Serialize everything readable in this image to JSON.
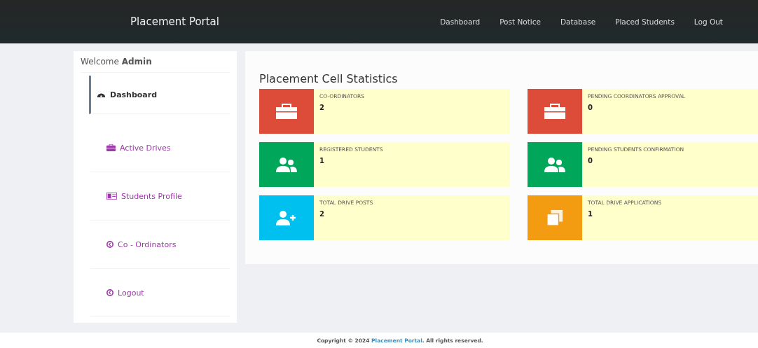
{
  "navbar": {
    "brand": "Placement Portal",
    "links": [
      {
        "label": "Dashboard"
      },
      {
        "label": "Post Notice"
      },
      {
        "label": "Database"
      },
      {
        "label": "Placed Students"
      },
      {
        "label": "Log Out"
      }
    ]
  },
  "sidebar": {
    "welcome": "Welcome **Admin**",
    "items": [
      {
        "label": "Dashboard",
        "kind": "dashboard",
        "selected": true
      },
      {
        "label": "Active Drives",
        "kind": "briefcase",
        "selected": false
      },
      {
        "label": "Students Profile",
        "kind": "idcard",
        "selected": false
      },
      {
        "label": "Co - Ordinators",
        "kind": "circle",
        "selected": false
      },
      {
        "label": "Logout",
        "kind": "circle",
        "selected": false
      }
    ]
  },
  "main": {
    "title": "Placement Cell Statistics",
    "cards": [
      {
        "label": "CO-ORDINATORS",
        "value": "2",
        "kind": "briefcase",
        "color": "#dd4b39"
      },
      {
        "label": "PENDING COORDINATORS APPROVAL",
        "value": "0",
        "kind": "briefcase",
        "color": "#dd4b39"
      },
      {
        "label": "REGISTERED STUDENTS",
        "value": "1",
        "kind": "users",
        "color": "#00a65a"
      },
      {
        "label": "PENDING STUDENTS CONFIRMATION",
        "value": "0",
        "kind": "users",
        "color": "#00a65a"
      },
      {
        "label": "TOTAL DRIVE POSTS",
        "value": "2",
        "kind": "userplus",
        "color": "#00c0ef"
      },
      {
        "label": "TOTAL DRIVE APPLICATIONS",
        "value": "1",
        "kind": "copy",
        "color": "#f39c12"
      }
    ]
  },
  "footer": {
    "prefix": "Copyright © 2024",
    "link": "Placement Portal",
    "suffix": ". All rights reserved."
  }
}
